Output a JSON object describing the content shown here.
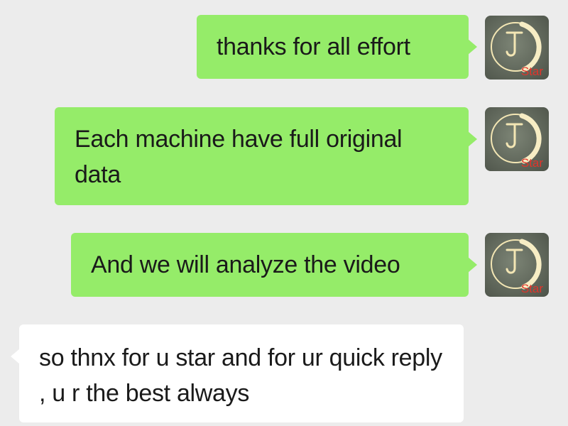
{
  "conversation": {
    "messages": [
      {
        "direction": "outgoing",
        "text": "thanks for all effort"
      },
      {
        "direction": "outgoing",
        "text": "Each machine have full original data"
      },
      {
        "direction": "outgoing",
        "text": "And we will analyze the video"
      },
      {
        "direction": "incoming",
        "text": "so thnx for u star and for ur quick reply , u r the best always"
      }
    ]
  },
  "avatar": {
    "monogram": "J",
    "label": "Star",
    "label_color": "#e0342b",
    "ring_color": "#f3e6b4"
  },
  "colors": {
    "background": "#ececec",
    "outgoing_bubble": "#95ec69",
    "incoming_bubble": "#ffffff"
  }
}
